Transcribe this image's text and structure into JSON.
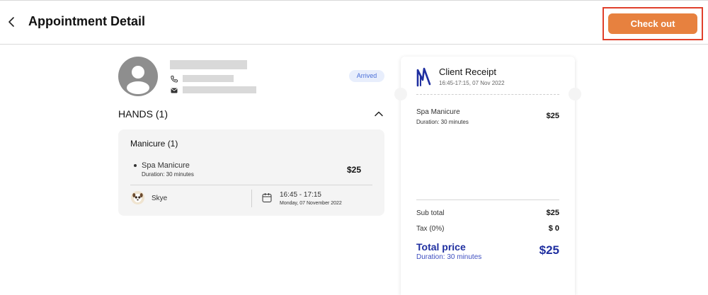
{
  "header": {
    "title": "Appointment Detail",
    "checkout_label": "Check out"
  },
  "client": {
    "status": "Arrived",
    "status_color": "#4a6fd8"
  },
  "section": {
    "title": "HANDS (1)"
  },
  "category": {
    "title": "Manicure (1)",
    "service": {
      "name": "Spa Manicure",
      "duration": "Duration: 30 minutes",
      "price": "$25"
    },
    "staff": "Skye",
    "time": "16:45 - 17:15",
    "date": "Monday, 07 November 2022"
  },
  "receipt": {
    "title": "Client Receipt",
    "subtitle": "16:45-17:15, 07 Nov 2022",
    "item_name": "Spa Manicure",
    "item_duration": "Duration: 30 minutes",
    "item_price": "$25",
    "subtotal_label": "Sub total",
    "subtotal": "$25",
    "tax_label": "Tax (0%)",
    "tax": "$ 0",
    "total_label": "Total price",
    "total_duration": "Duration: 30 minutes",
    "total": "$25"
  },
  "colors": {
    "accent": "#e7813f",
    "highlight_border": "#e0402c",
    "total_blue": "#1f2fa0"
  }
}
